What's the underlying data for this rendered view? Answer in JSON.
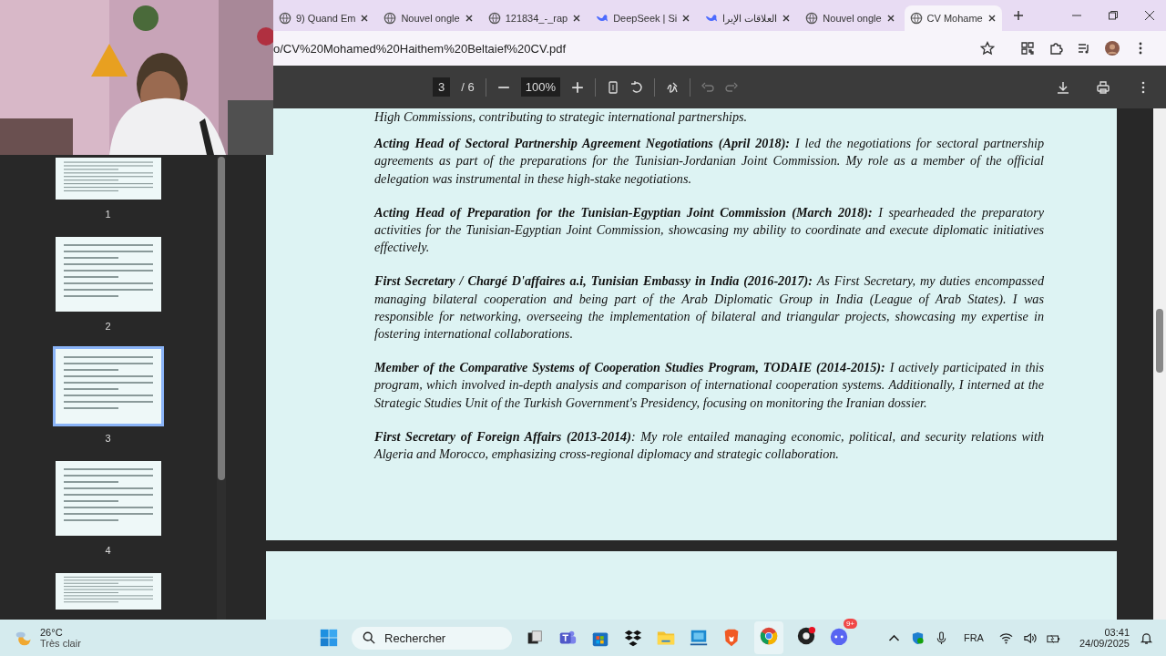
{
  "tabs": [
    {
      "title": "9) Quand Em",
      "selected": false
    },
    {
      "title": "Nouvel ongle",
      "selected": false
    },
    {
      "title": "121834_-_rap",
      "selected": false
    },
    {
      "title": "DeepSeek | Si",
      "selected": false
    },
    {
      "title": "العلاقات الإيرا",
      "selected": false
    },
    {
      "title": "Nouvel ongle",
      "selected": false
    },
    {
      "title": "CV Mohame",
      "selected": true
    }
  ],
  "address_bar": {
    "url": "o/CV%20Mohamed%20Haithem%20Beltaief%20CV.pdf"
  },
  "pdf_toolbar": {
    "page": "3",
    "total": "/ 6",
    "zoom": "100%"
  },
  "thumbnails": [
    {
      "label": "1",
      "selected": false
    },
    {
      "label": "2",
      "selected": false
    },
    {
      "label": "3",
      "selected": true
    },
    {
      "label": "4",
      "selected": false
    },
    {
      "selected": false
    }
  ],
  "document": {
    "cut_line": "High Commissions, contributing to strategic international partnerships.",
    "paragraphs": [
      "**Acting Head of Sectoral Partnership Agreement Negotiations (April 2018):** I led the negotiations for sectoral partnership agreements as part of the preparations for the Tunisian-Jordanian Joint Commission. My role as a member of the official delegation was instrumental in these high-stake negotiations.",
      "**Acting Head of Preparation for the Tunisian-Egyptian Joint Commission (March 2018):** I spearheaded the preparatory activities for the Tunisian-Egyptian Joint Commission, showcasing my ability to coordinate and execute diplomatic initiatives effectively.",
      "**First Secretary / Chargé D'affaires a.i, Tunisian Embassy in India (2016-2017):** As First Secretary, my duties encompassed managing bilateral cooperation and being part of the Arab Diplomatic Group in India (League of Arab States). I was responsible for networking, overseeing the implementation of bilateral and triangular projects, showcasing my expertise in fostering international collaborations.",
      "**Member of the Comparative Systems of Cooperation Studies Program, TODAIE (2014-2015):** I actively participated in this program, which involved in-depth analysis and comparison of international cooperation systems. Additionally, I interned at the Strategic Studies Unit of the Turkish Government's Presidency, focusing on monitoring the Iranian dossier.",
      "**First Secretary of Foreign Affairs (2013-2014)**: My role entailed managing economic, political, and security relations with Algeria and Morocco, emphasizing cross-regional diplomacy and strategic collaboration."
    ]
  },
  "taskbar": {
    "temperature": "26°C",
    "weather": "Très clair",
    "search_placeholder": "Rechercher",
    "notification_badge": "9+",
    "language": "FRA",
    "time": "03:41",
    "date": "24/09/2025"
  }
}
